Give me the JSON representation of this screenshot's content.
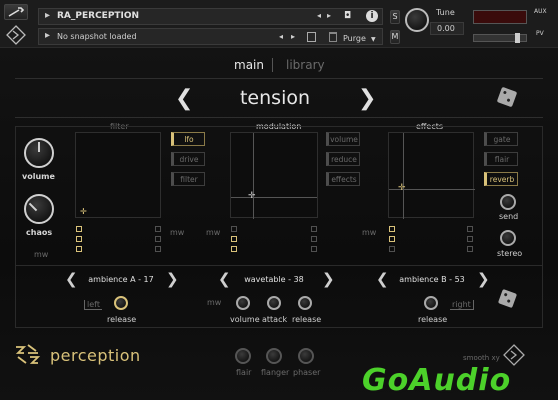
{
  "header": {
    "instrument_name": "RA_PERCEPTION",
    "snapshot": "No snapshot loaded",
    "purge_label": "Purge",
    "tune_label": "Tune",
    "tune_value": "0.00",
    "s_label": "S",
    "m_label": "M",
    "aux_label": "AUX",
    "pv_label": "PV"
  },
  "nav": {
    "tab_main": "main",
    "tab_library": "library",
    "preset_name": "tension"
  },
  "sections": {
    "filter": "filter",
    "modulation": "modulation",
    "effects": "effects"
  },
  "left_controls": {
    "volume": "volume",
    "chaos": "chaos",
    "mw": "mw"
  },
  "filter_slots": [
    "lfo",
    "drive",
    "filter"
  ],
  "modulation_slots": [
    "volume",
    "reduce",
    "effects"
  ],
  "effects_slots": [
    "gate",
    "flair",
    "reverb"
  ],
  "effects_knobs": {
    "send": "send",
    "stereo": "stereo"
  },
  "mw_labels": {
    "filter": "mw",
    "mod_left": "mw",
    "mod_right": "mw",
    "bottom_mid": "mw"
  },
  "layers": {
    "a": {
      "name": "ambience A - 17",
      "side": "left",
      "knob": "release"
    },
    "b": {
      "name": "wavetable - 38",
      "knobs": [
        "volume",
        "attack",
        "release"
      ]
    },
    "c": {
      "name": "ambience B - 53",
      "side": "right",
      "knob": "release"
    }
  },
  "footer": {
    "brand": "perception",
    "fx_knobs": [
      "flair",
      "flanger",
      "phaser"
    ],
    "smooth_label": "smooth xy"
  },
  "watermark": "GoAudio",
  "colors": {
    "accent": "#d9c27a",
    "watermark": "#4cd12a"
  }
}
